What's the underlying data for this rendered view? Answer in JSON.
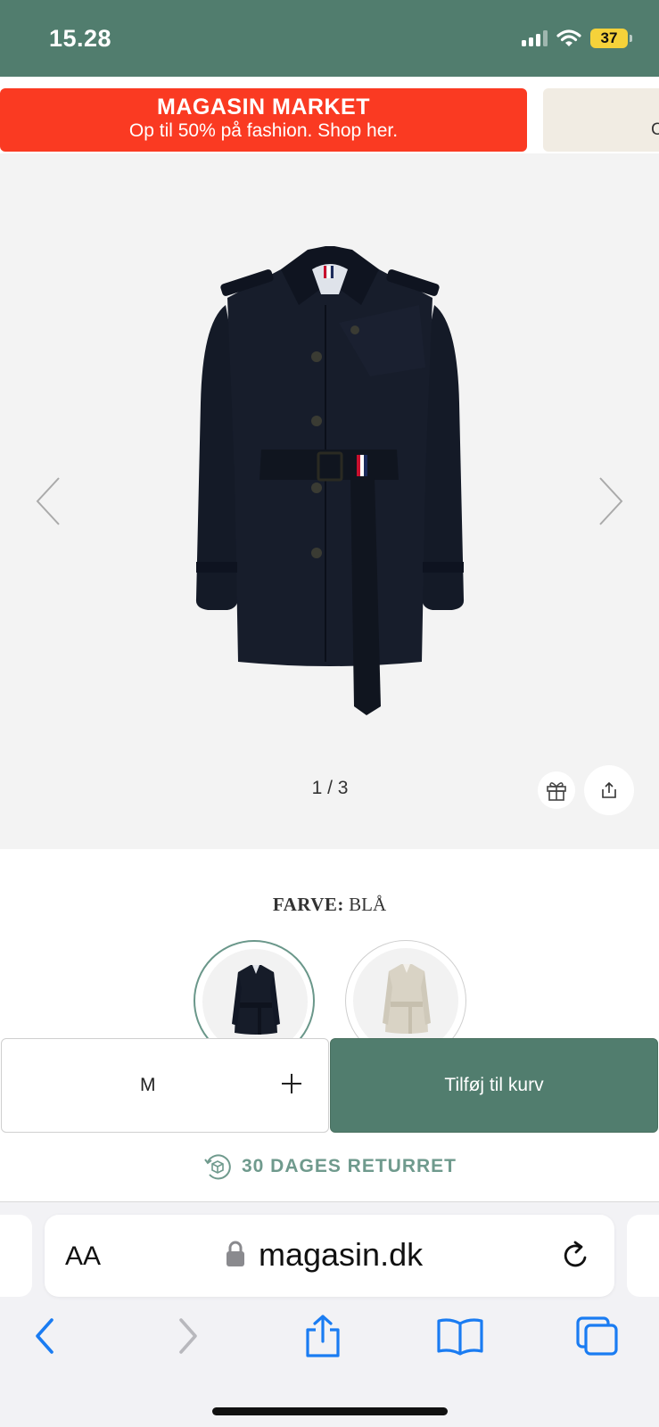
{
  "status_bar": {
    "time": "15.28",
    "battery": "37",
    "background_color": "#517d6e"
  },
  "promo": {
    "title": "MAGASIN MARKET",
    "subtitle": "Op til 50% på fashion. Shop her.",
    "color": "#fa3a22",
    "next_banner_partial": "C"
  },
  "gallery": {
    "counter": "1 / 3",
    "icons": [
      "chevron-left-icon",
      "chevron-right-icon",
      "gift-icon",
      "share-icon"
    ]
  },
  "color": {
    "label": "FARVE:",
    "value": "BLÅ",
    "swatches": [
      {
        "name": "navy",
        "selected": true
      },
      {
        "name": "beige",
        "selected": false
      }
    ]
  },
  "buy": {
    "size": "M",
    "add_to_cart": "Tilføj til kurv",
    "accent": "#517d6e"
  },
  "returns": {
    "text": "30 DAGES RETURRET"
  },
  "browser": {
    "aa_label": "AA",
    "url": "magasin.dk",
    "toolbar": [
      "back",
      "forward",
      "share",
      "bookmarks",
      "tabs"
    ]
  }
}
